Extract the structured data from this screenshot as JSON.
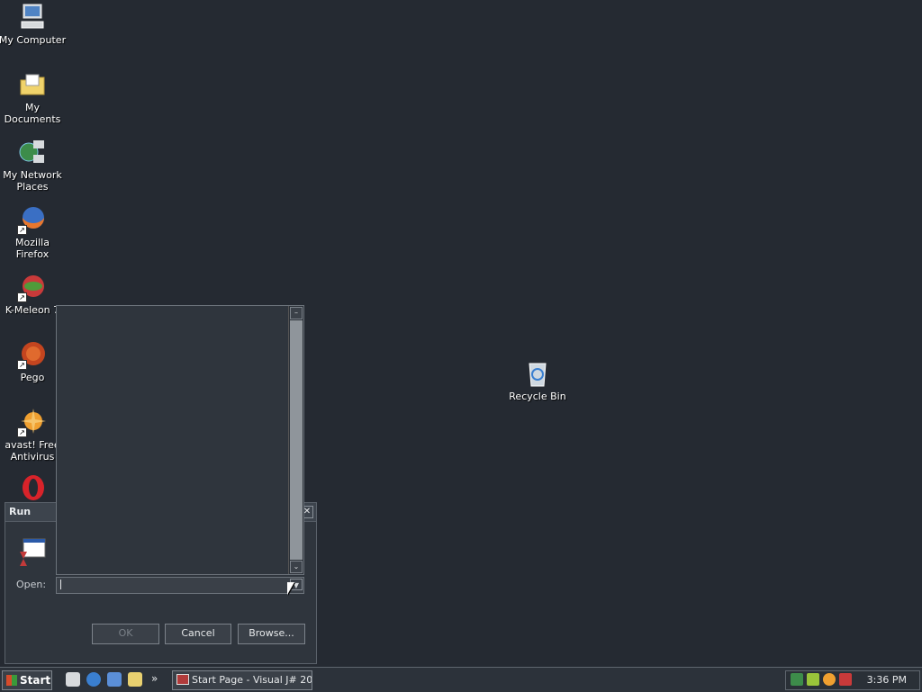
{
  "desktop": {
    "icons": [
      {
        "label": "My Computer",
        "icon": "computer-icon"
      },
      {
        "label": "My Documents",
        "icon": "folder-icon"
      },
      {
        "label": "My Network Places",
        "icon": "network-icon"
      },
      {
        "label": "Mozilla Firefox",
        "icon": "firefox-icon"
      },
      {
        "label": "K-Meleon 7",
        "icon": "kmeleon-icon"
      },
      {
        "label": "Pego",
        "icon": "pego-icon"
      },
      {
        "label": "avast! Free Antivirus",
        "icon": "avast-icon"
      },
      {
        "label": "",
        "icon": "opera-icon"
      },
      {
        "label": "Recycle Bin",
        "icon": "recycle-bin-icon"
      }
    ]
  },
  "run_dialog": {
    "title": "Run",
    "close_glyph": "✕",
    "open_label": "Open:",
    "open_value": "",
    "ok_label": "OK",
    "cancel_label": "Cancel",
    "browse_label": "Browse..."
  },
  "taskbar": {
    "start_label": "Start",
    "chevron": "»",
    "task_label": "Start Page - Visual J# 20...",
    "clock": "3:36 PM"
  }
}
